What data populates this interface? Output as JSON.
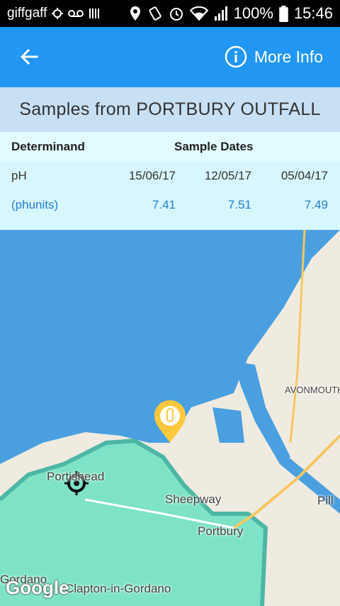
{
  "status_bar": {
    "carrier": "giffgaff",
    "battery": "100%",
    "time": "15:46"
  },
  "app_bar": {
    "back_icon": "arrow-left-icon",
    "more_info_label": "More Info",
    "more_info_icon": "info-circle-icon"
  },
  "title": "Samples from PORTBURY OUTFALL",
  "table": {
    "header": {
      "col1": "Determinand",
      "col2": "Sample Dates"
    },
    "dates": [
      "15/06/17",
      "12/05/17",
      "05/04/17"
    ],
    "determinand": "pH",
    "units": "(phunits)",
    "values": [
      "7.41",
      "7.51",
      "7.49"
    ]
  },
  "map": {
    "labels": {
      "avonmouth": "AVONMOUTH",
      "portishead": "Portishead",
      "sheepway": "Sheepway",
      "portbury": "Portbury",
      "pill": "Pill",
      "clapton": "Clapton-in-Gordano",
      "gordano": "Gordano"
    },
    "marker_icon": "test-tube-marker-icon",
    "location_icon": "my-location-icon",
    "logo": "Google"
  },
  "colors": {
    "primary": "#2196F3",
    "accent_text": "#2380D6",
    "sea": "#4A9FE0",
    "land": "#EFEBE1",
    "marker": "#FFC83D"
  }
}
